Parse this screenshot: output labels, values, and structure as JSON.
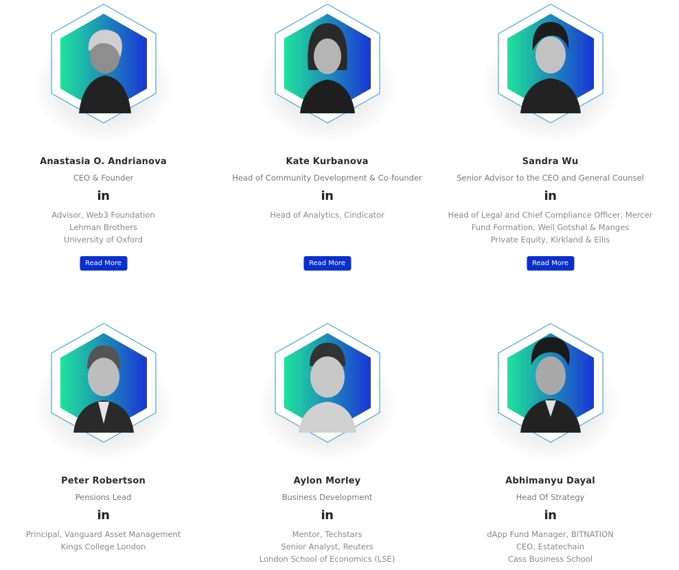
{
  "colors": {
    "accent_button": "#0a2fd1",
    "hex_gradient_start": "#1fe39a",
    "hex_gradient_end": "#1a36d6",
    "hex_outline": "#4aa3e0"
  },
  "team": [
    {
      "name": "Anastasia O. Andrianova",
      "role": "CEO & Founder",
      "linkedin_label": "in",
      "bio": [
        "Advisor, Web3 Foundation",
        "Lehman Brothers",
        "University of Oxford"
      ],
      "read_more": "Read More"
    },
    {
      "name": "Kate Kurbanova",
      "role": "Head of Community Development & Co-founder",
      "linkedin_label": "in",
      "bio": [
        "Head of Analytics, Cindicator"
      ],
      "read_more": "Read More"
    },
    {
      "name": "Sandra Wu",
      "role": "Senior Advisor to the CEO and General Counsel",
      "linkedin_label": "in",
      "bio": [
        "Head of Legal and Chief Compliance Officer, Mercer",
        "Fund Formation, Weil Gotshal & Manges",
        "Private Equity, Kirkland & Ellis"
      ],
      "read_more": "Read More"
    },
    {
      "name": "Peter Robertson",
      "role": "Pensions Lead",
      "linkedin_label": "in",
      "bio": [
        "Principal, Vanguard Asset Management",
        "Kings College London"
      ]
    },
    {
      "name": "Aylon Morley",
      "role": "Business Development",
      "linkedin_label": "in",
      "bio": [
        "Mentor, Techstars",
        "Senior Analyst, Reuters",
        "London School of Economics (LSE)"
      ]
    },
    {
      "name": "Abhimanyu Dayal",
      "role": "Head Of Strategy",
      "linkedin_label": "in",
      "bio": [
        "dApp Fund Manager, BITNATION",
        "CEO, Estatechain",
        "Cass Business School"
      ]
    }
  ]
}
